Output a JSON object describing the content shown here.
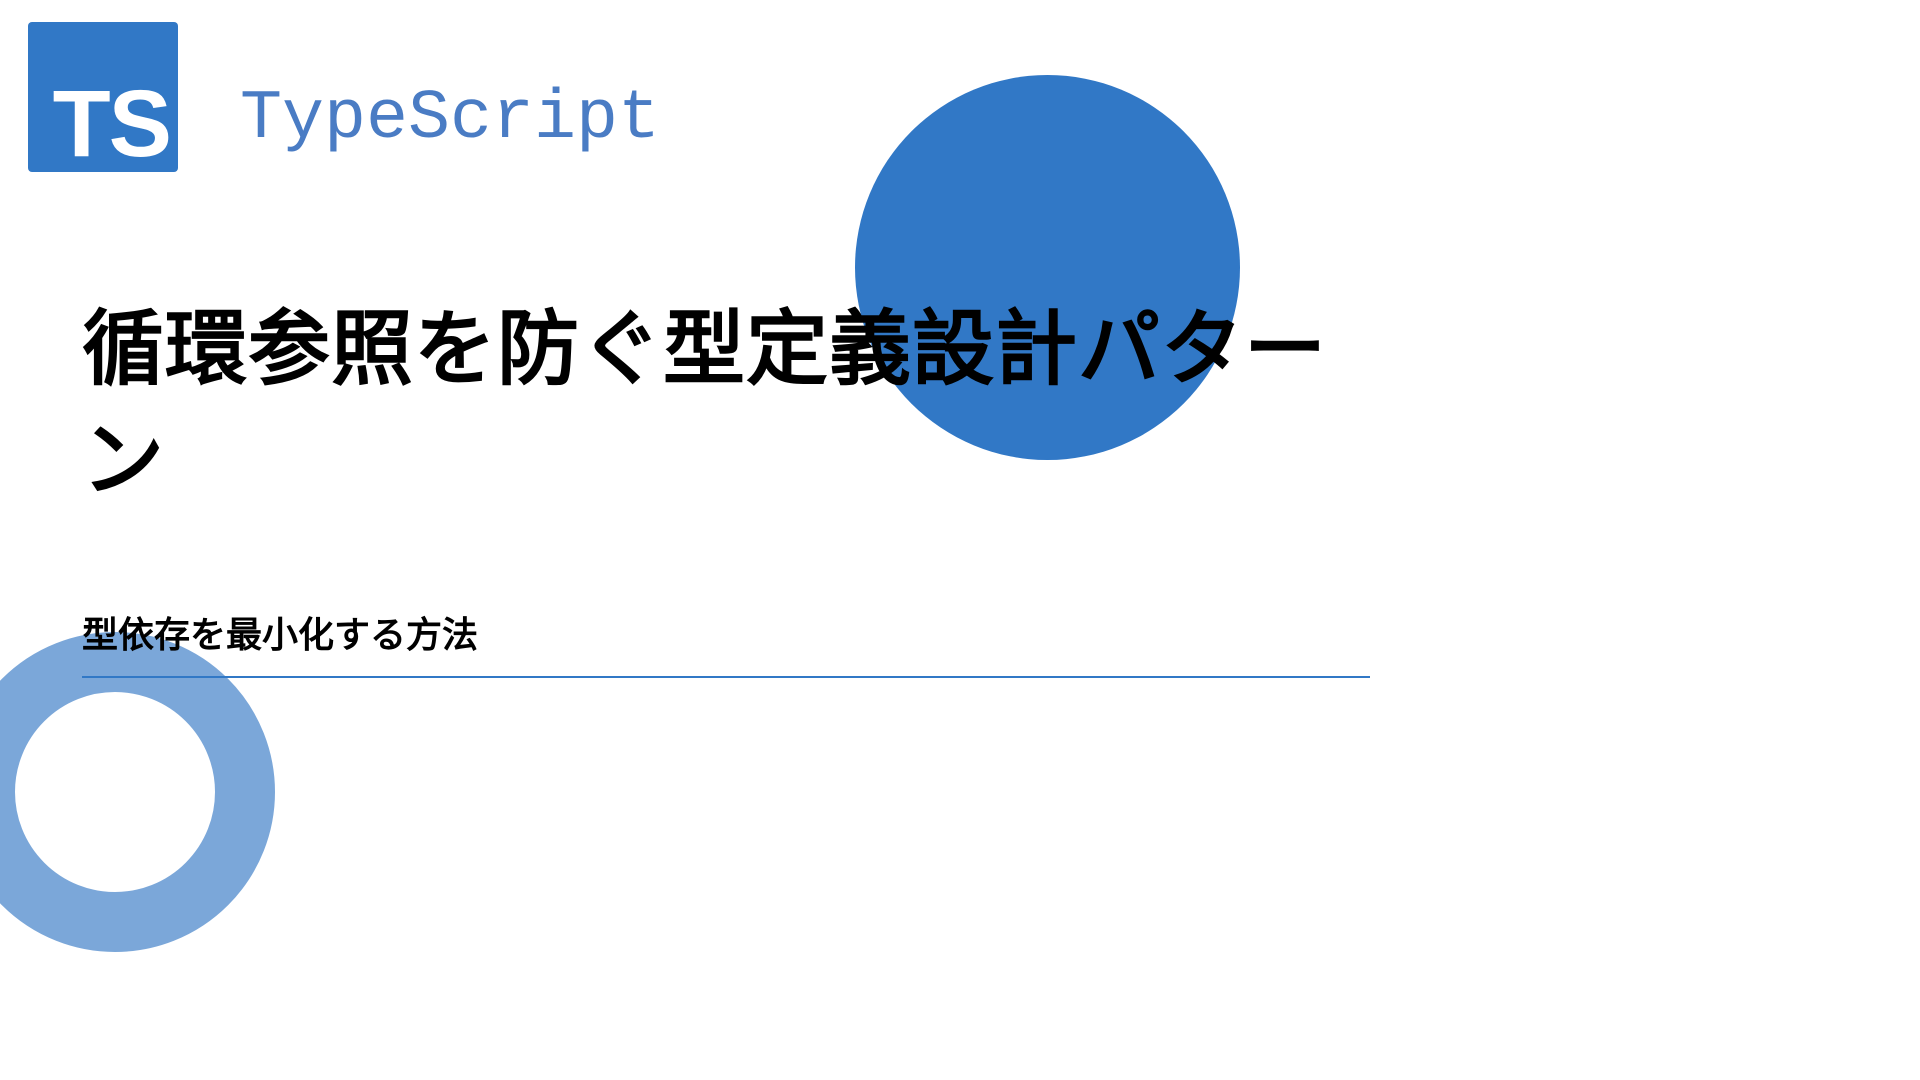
{
  "logo": {
    "text": "TS",
    "brand": "TypeScript"
  },
  "title": "循環参照を防ぐ型定義設計パターン",
  "subtitle": "型依存を最小化する方法",
  "colors": {
    "primary": "#3178c6",
    "primary_light": "#7ba7d9",
    "brand_text": "#4a7cc4"
  }
}
